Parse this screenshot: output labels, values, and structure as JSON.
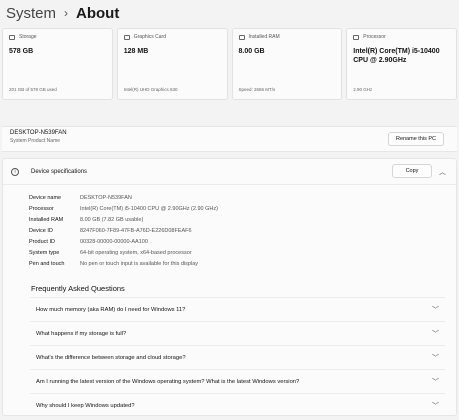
{
  "breadcrumb": {
    "parent": "System",
    "separator": "›",
    "current": "About"
  },
  "cards": [
    {
      "label": "Storage",
      "value": "578 GB",
      "sub": "201 GB of 578 GB used"
    },
    {
      "label": "Graphics Card",
      "value": "128 MB",
      "sub": "Intel(R) UHD Graphics 630"
    },
    {
      "label": "Installed RAM",
      "value": "8.00 GB",
      "sub": "Speed: 2666 MT/s"
    },
    {
      "label": "Processor",
      "value": "Intel(R) Core(TM) i5-10400 CPU @ 2.90GHz",
      "sub": "2.90 GHz"
    }
  ],
  "device": {
    "name": "DESKTOP-N539FAN",
    "label": "System Product Name",
    "rename_label": "Rename this PC"
  },
  "specs_panel": {
    "title": "Device specifications",
    "copy_label": "Copy",
    "rows": [
      {
        "label": "Device name",
        "value": "DESKTOP-N539FAN"
      },
      {
        "label": "Processor",
        "value": "Intel(R) Core(TM) i5-10400 CPU @ 2.90GHz (2.90 GHz)"
      },
      {
        "label": "Installed RAM",
        "value": "8.00 GB (7.82 GB usable)"
      },
      {
        "label": "Device ID",
        "value": "8247F060-7F89-47FB-A76D-E226D08FEAF6"
      },
      {
        "label": "Product ID",
        "value": "00328-00000-00000-AA100"
      },
      {
        "label": "System type",
        "value": "64-bit operating system, x64-based processor"
      },
      {
        "label": "Pen and touch",
        "value": "No pen or touch input is available for this display"
      }
    ]
  },
  "faq": {
    "title": "Frequently Asked Questions",
    "items": [
      "How much memory (aka RAM) do I need for Windows 11?",
      "What happens if my storage is full?",
      "What's the difference between storage and cloud storage?",
      "Am I running the latest version of the Windows operating system? What is the latest Windows version?",
      "Why should I keep Windows updated?"
    ]
  }
}
